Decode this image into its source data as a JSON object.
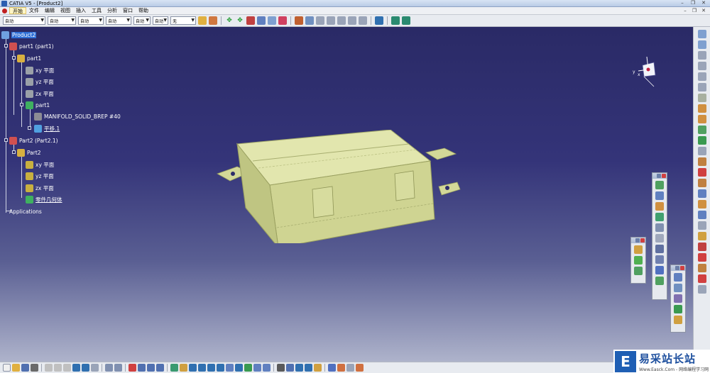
{
  "window": {
    "title": "CATIA V5 - [Product2]"
  },
  "menu": {
    "items": [
      "开始",
      "文件",
      "编辑",
      "视图",
      "插入",
      "工具",
      "分析",
      "窗口",
      "帮助"
    ]
  },
  "top_toolbar": {
    "combos": [
      "自动",
      "自动",
      "自动",
      "自动",
      "自动",
      "自动",
      "无"
    ]
  },
  "tree": {
    "nodes": [
      {
        "label": "Product2",
        "icon": "product-icon",
        "selected": true
      },
      {
        "label": "part1 (part1)",
        "icon": "part-instance-icon"
      },
      {
        "label": "part1",
        "icon": "part-gear-icon"
      },
      {
        "label": "xy 平面",
        "icon": "plane-icon"
      },
      {
        "label": "yz 平面",
        "icon": "plane-icon"
      },
      {
        "label": "zx 平面",
        "icon": "plane-icon"
      },
      {
        "label": "part1",
        "icon": "part-body-icon"
      },
      {
        "label": "MANIFOLD_SOLID_BREP #40",
        "icon": "solid-icon"
      },
      {
        "label": "平移.1",
        "icon": "translate-icon"
      },
      {
        "label": "Part2 (Part2.1)",
        "icon": "part-instance-icon"
      },
      {
        "label": "Part2",
        "icon": "part-gear-icon"
      },
      {
        "label": "xy 平面",
        "icon": "plane-icon"
      },
      {
        "label": "yz 平面",
        "icon": "plane-icon"
      },
      {
        "label": "zx 平面",
        "icon": "plane-icon"
      },
      {
        "label": "零件几何体",
        "icon": "part-body-icon"
      },
      {
        "label": "Applications",
        "icon": ""
      }
    ]
  },
  "compass": {
    "x_label": "x",
    "y_label": "y",
    "z_label": "z"
  },
  "watermark": {
    "text": "易采站长站",
    "url": "Www.Easck.Com - 网络编程学习网"
  },
  "colors": {
    "viewport_top": "#2a2a66",
    "viewport_bottom": "#aeb3cb",
    "model_fill": "#dfe3a6",
    "selection": "#2f6fd6"
  }
}
